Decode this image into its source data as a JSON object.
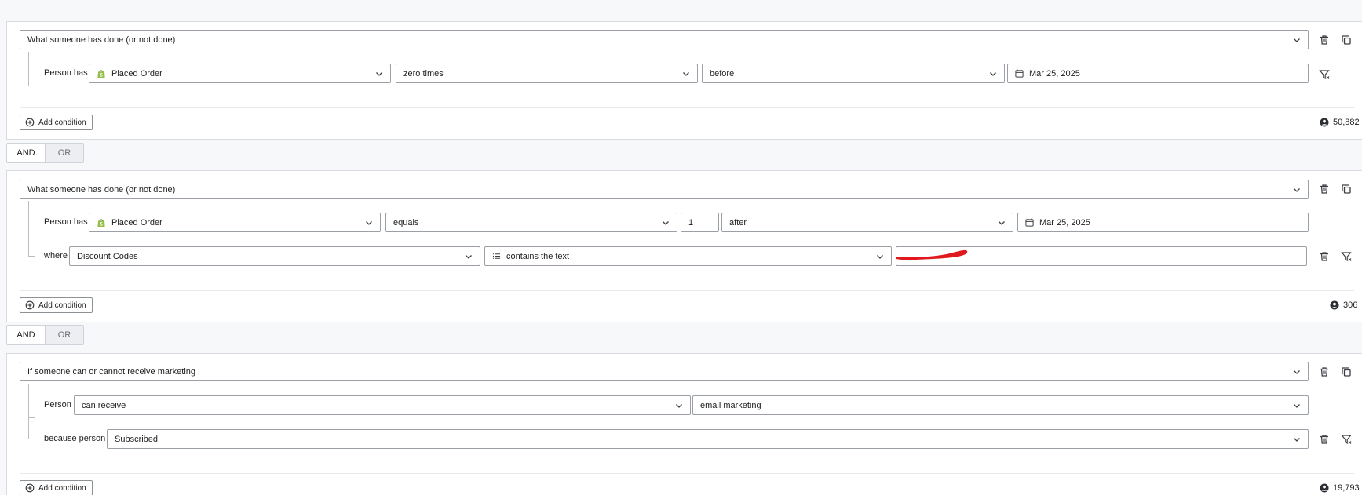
{
  "group1": {
    "definition": "What someone has done (or not done)",
    "row1": {
      "prefix": "Person has",
      "metric": "Placed Order",
      "frequency": "zero times",
      "time_op": "before",
      "date": "Mar 25, 2025"
    },
    "add_condition": "Add condition",
    "count": "50,882"
  },
  "join1": {
    "and": "AND",
    "or": "OR",
    "selected": "AND"
  },
  "group2": {
    "definition": "What someone has done (or not done)",
    "row1": {
      "prefix": "Person has",
      "metric": "Placed Order",
      "frequency": "equals",
      "amount": "1",
      "time_op": "after",
      "date": "Mar 25, 2025"
    },
    "row2": {
      "prefix": "where",
      "property": "Discount Codes",
      "operator": "contains the text",
      "value": ""
    },
    "add_condition": "Add condition",
    "count": "306"
  },
  "join2": {
    "and": "AND",
    "or": "OR",
    "selected": "AND"
  },
  "group3": {
    "definition": "If someone can or cannot receive marketing",
    "row1": {
      "prefix": "Person",
      "consent": "can receive",
      "channel": "email marketing"
    },
    "row2": {
      "prefix": "because person",
      "reason": "Subscribed"
    },
    "add_condition": "Add condition",
    "count": "19,793"
  },
  "colors": {
    "redaction": "#e0191f",
    "border": "#9aa0a6",
    "shopify": "#95bf47"
  },
  "icons": [
    "chevron-down-icon",
    "trash-icon",
    "copy-icon",
    "filter-icon",
    "calendar-icon",
    "shopify-icon",
    "list-icon",
    "plus-circle-icon",
    "person-icon"
  ]
}
